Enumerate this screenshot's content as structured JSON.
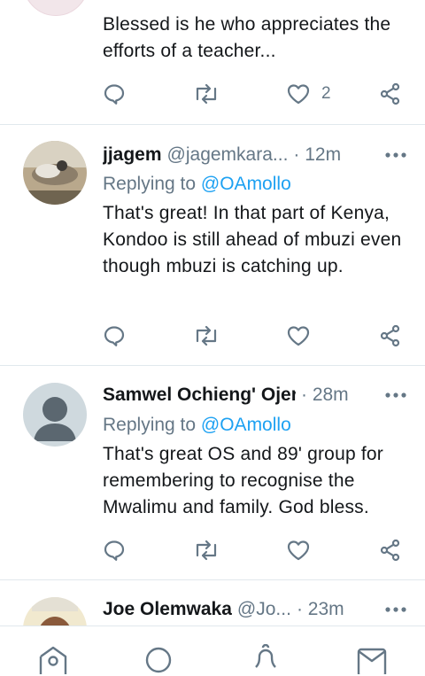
{
  "tweets": [
    {
      "body": "Blessed is he who appreciates the efforts of a teacher...",
      "likes": "2"
    },
    {
      "name": "jjagem",
      "handle": "@jagemkara...",
      "time": "· 12m",
      "replying_label": "Replying to",
      "replying_to": "@OAmollo",
      "body": "That's great! In that part of Kenya, Kondoo is still ahead of mbuzi even though mbuzi is catching up.",
      "likes": ""
    },
    {
      "name": "Samwel Ochieng' Ojer",
      "handle": "",
      "time": "· 28m",
      "replying_label": "Replying to",
      "replying_to": "@OAmollo",
      "body": "That's great OS and 89' group for remembering to recognise the Mwalimu and family. God bless.",
      "likes": ""
    },
    {
      "name": "Joe Olemwaka",
      "handle": "@Jo...",
      "time": "· 23m"
    }
  ],
  "icons": {
    "reply": "reply-icon",
    "retweet": "retweet-icon",
    "like": "heart-icon",
    "share": "share-icon",
    "more": "more-icon",
    "home": "home-icon",
    "search": "search-icon",
    "notifications": "bell-icon",
    "messages": "mail-icon"
  },
  "colors": {
    "accent": "#1da1f2",
    "secondary_text": "#657786",
    "icon": "#657786",
    "divider": "#e1e8ed"
  }
}
